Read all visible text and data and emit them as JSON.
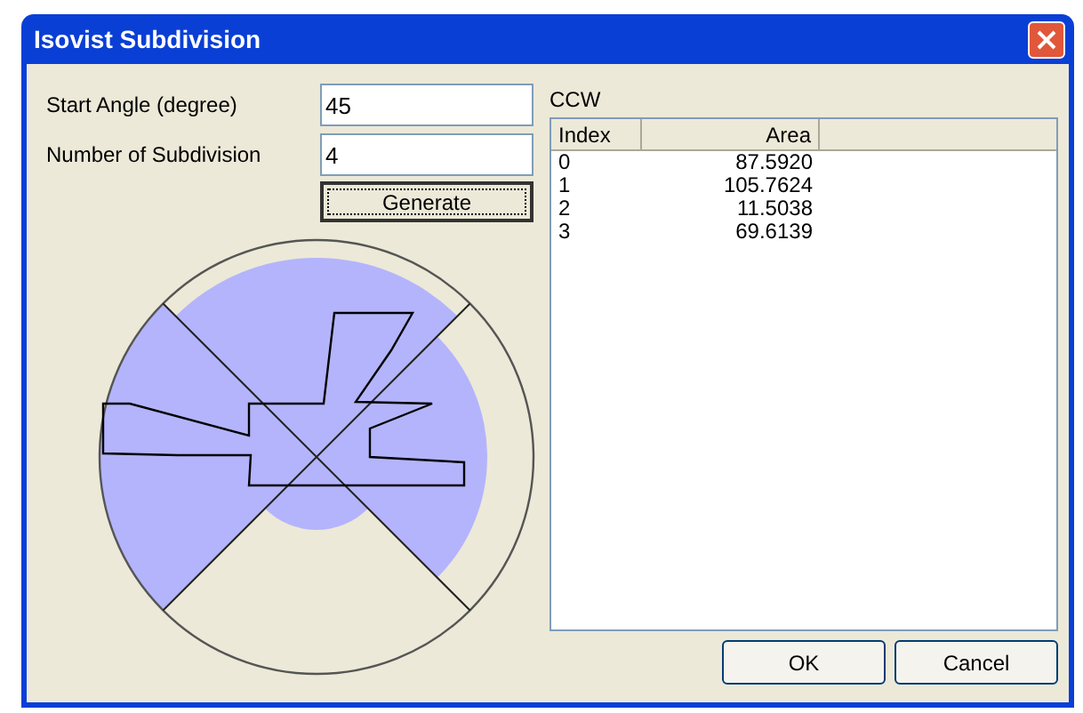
{
  "window": {
    "title": "Isovist Subdivision"
  },
  "fields": [
    {
      "label": "Start Angle (degree)",
      "value": "45"
    },
    {
      "label": "Number of Subdivision",
      "value": "4"
    }
  ],
  "generate_button": "Generate",
  "list": {
    "caption": "CCW",
    "columns": [
      "Index",
      "Area"
    ],
    "rows": [
      [
        "0",
        "87.5920"
      ],
      [
        "1",
        "105.7624"
      ],
      [
        "2",
        "11.5038"
      ],
      [
        "3",
        "69.6139"
      ]
    ]
  },
  "buttons": [
    "OK",
    "Cancel"
  ]
}
